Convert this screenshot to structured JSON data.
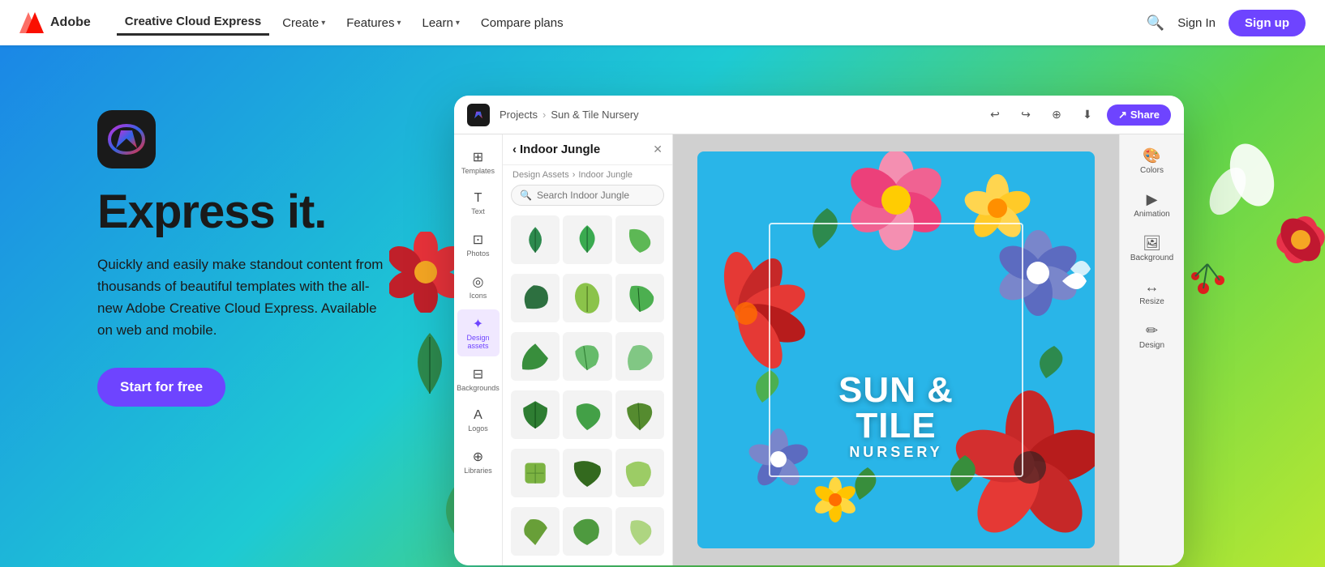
{
  "nav": {
    "logo_text": "Adobe",
    "app_name": "Creative Cloud Express",
    "links": [
      {
        "label": "Create",
        "has_chevron": true,
        "active": false
      },
      {
        "label": "Features",
        "has_chevron": true,
        "active": false
      },
      {
        "label": "Learn",
        "has_chevron": true,
        "active": false
      },
      {
        "label": "Compare plans",
        "has_chevron": false,
        "active": false
      }
    ],
    "sign_in": "Sign In",
    "sign_up": "Sign up",
    "search_aria": "Search"
  },
  "hero": {
    "title": "Express it.",
    "description": "Quickly and easily make standout content from thousands of beautiful templates with the all-new Adobe Creative Cloud Express. Available on web and mobile.",
    "cta": "Start for free"
  },
  "app_ui": {
    "breadcrumb_projects": "Projects",
    "breadcrumb_sep": "›",
    "breadcrumb_project": "Sun & Tile Nursery",
    "share_btn": "Share",
    "panel_title": "Indoor Jungle",
    "panel_breadcrumb_prefix": "Design Assets",
    "panel_breadcrumb_item": "Indoor Jungle",
    "panel_search_placeholder": "Search Indoor Jungle",
    "sidebar_items": [
      {
        "icon": "⊞",
        "label": "Templates"
      },
      {
        "icon": "T",
        "label": "Text"
      },
      {
        "icon": "⊡",
        "label": "Photos"
      },
      {
        "icon": "◎",
        "label": "Icons"
      },
      {
        "icon": "✦",
        "label": "Design assets"
      },
      {
        "icon": "⊟",
        "label": "Backgrounds"
      },
      {
        "icon": "A",
        "label": "Logos"
      },
      {
        "icon": "⊕",
        "label": "Libraries"
      }
    ],
    "right_props": [
      {
        "icon": "🎨",
        "label": "Colors"
      },
      {
        "icon": "▶",
        "label": "Animation"
      },
      {
        "icon": "🖼",
        "label": "Background"
      },
      {
        "icon": "↔",
        "label": "Resize"
      },
      {
        "icon": "✏",
        "label": "Design"
      }
    ],
    "canvas_text_line1": "SUN & TILE",
    "canvas_text_line2": "NURSERY"
  },
  "colors": {
    "accent_purple": "#6e44ff",
    "hero_blue": "#1b87e6",
    "hero_green": "#b8e832",
    "nav_bg": "#ffffff"
  }
}
